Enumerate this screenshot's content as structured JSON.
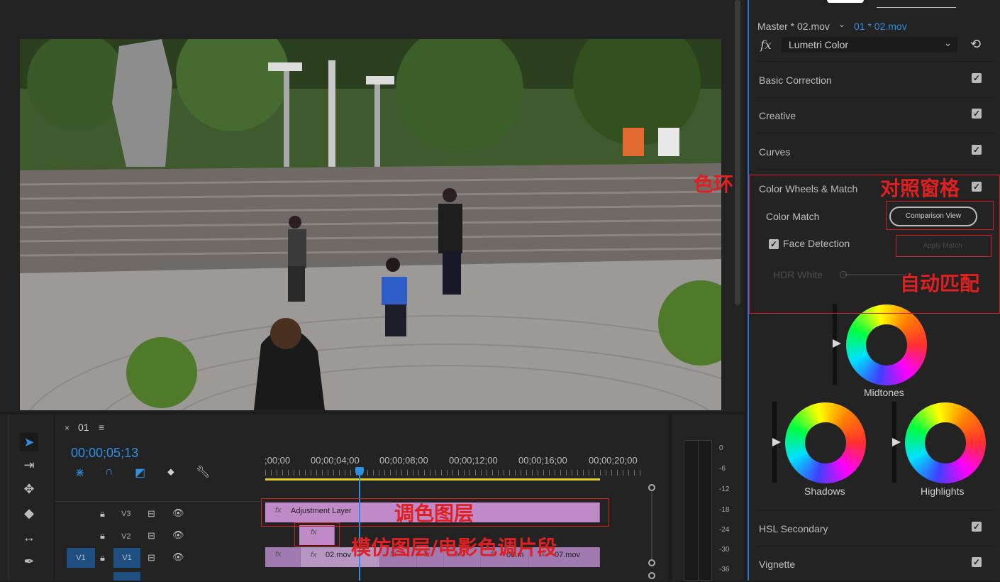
{
  "lumetri": {
    "master_clip": "Master * 02.mov",
    "active_clip": "01 * 02.mov",
    "fx_symbol": "fx",
    "effect_name": "Lumetri Color",
    "sections": {
      "basic": "Basic Correction",
      "creative": "Creative",
      "curves": "Curves",
      "color_wheels": "Color Wheels & Match",
      "hsl": "HSL Secondary",
      "vignette": "Vignette"
    },
    "color_match_label": "Color Match",
    "comparison_view": "Comparison View",
    "apply_match": "Apply Match",
    "face_detection": "Face Detection",
    "hdr_white": "HDR White",
    "wheels": {
      "midtones": "Midtones",
      "shadows": "Shadows",
      "highlights": "Highlights"
    }
  },
  "annotations": {
    "color_wheel": "色环",
    "comparison_pane": "对照窗格",
    "auto_match": "自动匹配",
    "grading_layer": "调色图层",
    "imitation_layer": "模仿图层/电影色调片段"
  },
  "timeline": {
    "sequence_name": "01",
    "timecode": "00;00;05;13",
    "ruler": ";00;00",
    "ruler2": "00;00;04;00",
    "ruler3": "00;00;08;00",
    "ruler4": "00;00;12;00",
    "ruler5": "00;00;16;00",
    "ruler6": "00;00;20;00",
    "tracks": {
      "v3": "V3",
      "v2": "V2",
      "v1": "V1",
      "v1_source": "V1"
    },
    "clips": {
      "adjustment": "Adjustment Layer",
      "clip02": "02.mov",
      "clip06": "06.m",
      "clip07": "07.mov",
      "fx": "fx"
    }
  },
  "meter": {
    "db0": "0",
    "db1": "-6",
    "db2": "-12",
    "db3": "-18",
    "db4": "-24",
    "db5": "-30",
    "db6": "-36"
  },
  "colors": {
    "accent_blue": "#2f8fe0",
    "clip_purple": "#c089c7",
    "annotation_red": "#e02020",
    "playhead": "#2f8fe0"
  }
}
